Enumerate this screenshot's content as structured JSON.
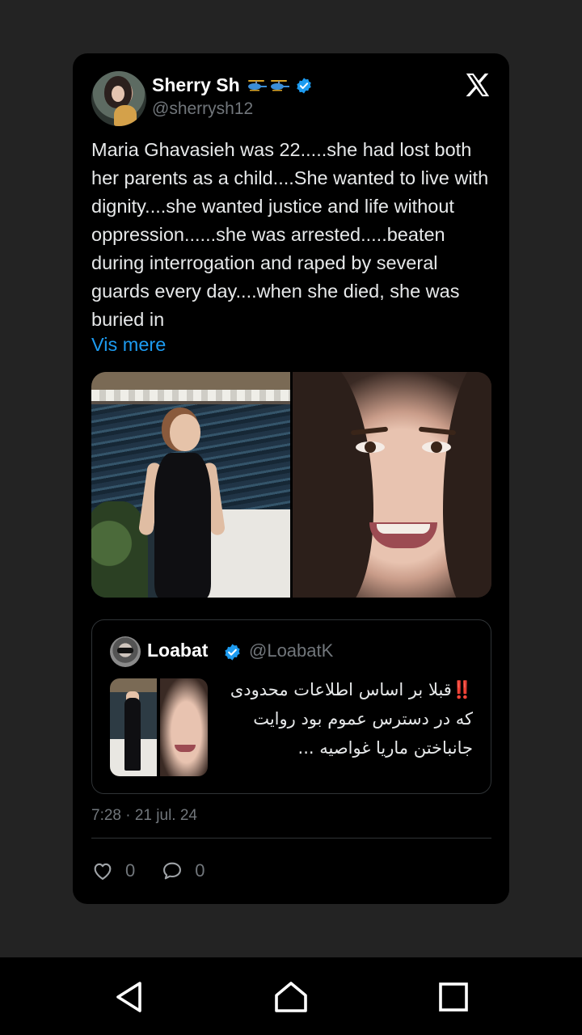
{
  "tweet": {
    "author_name": "Sherry Sh",
    "author_emoji": [
      "helicopter-emoji",
      "helicopter-emoji"
    ],
    "author_handle": "@sherrysh12",
    "text": "Maria Ghavasieh was 22.....she had lost both her parents as a child....She wanted to live with dignity....she wanted justice and life without oppression......she was arrested.....beaten during interrogation and raped by several guards every day....when she died, she was buried in",
    "show_more": "Vis mere",
    "timestamp": "7:28 · 21 jul. 24",
    "likes": "0",
    "replies": "0"
  },
  "quoted": {
    "author_name": "Loabat",
    "author_handle": "@LoabatK",
    "text": "‼️قبلا بر اساس اطلاعات محدودی که در دسترس عموم بود روایت جانباختن ماریا غواصیه ..."
  },
  "icons": {
    "verified": "verified-badge-icon",
    "brand": "x-logo-icon",
    "like": "heart-icon",
    "reply": "reply-icon",
    "nav": [
      "back-icon",
      "home-icon",
      "recents-icon"
    ]
  },
  "colors": {
    "background": "#232323",
    "card": "#000000",
    "text": "#e7e9ea",
    "muted": "#71767b",
    "link": "#1d9bf0",
    "verified": "#1d9bf0"
  }
}
